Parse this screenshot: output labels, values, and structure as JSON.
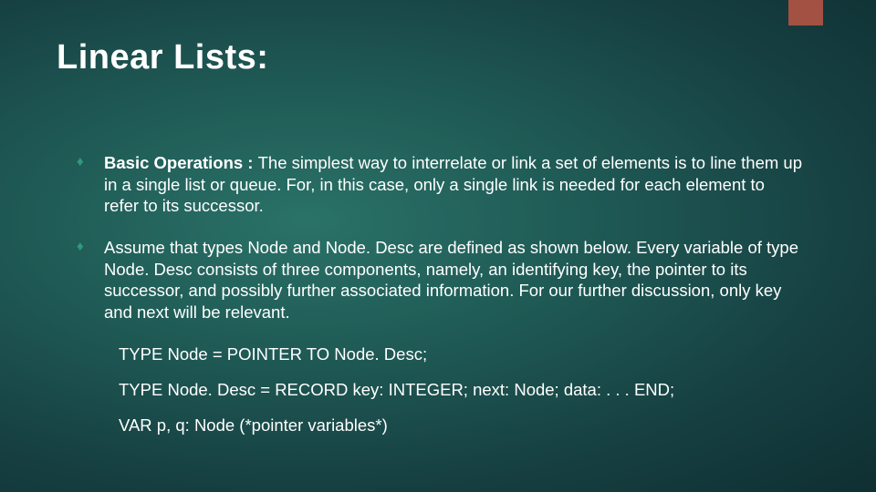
{
  "accent_color": "#a35142",
  "title": "Linear Lists:",
  "bullets": [
    {
      "lead": "Basic Operations : ",
      "text": "The simplest way to interrelate or link a set of elements is to line them up in a single list or queue. For, in this case, only a single link is needed for each element to refer to its successor."
    },
    {
      "lead": "",
      "text": "Assume that types Node and Node. Desc are defined as shown below. Every variable of type Node. Desc consists of three components, namely, an identifying key, the pointer to its successor, and possibly further associated information. For our further discussion, only key and next will be relevant."
    }
  ],
  "code_lines": [
    "TYPE Node = POINTER TO Node. Desc;",
    "TYPE Node. Desc = RECORD key: INTEGER; next: Node; data: . . . END;",
    "VAR p, q: Node (*pointer variables*)"
  ]
}
